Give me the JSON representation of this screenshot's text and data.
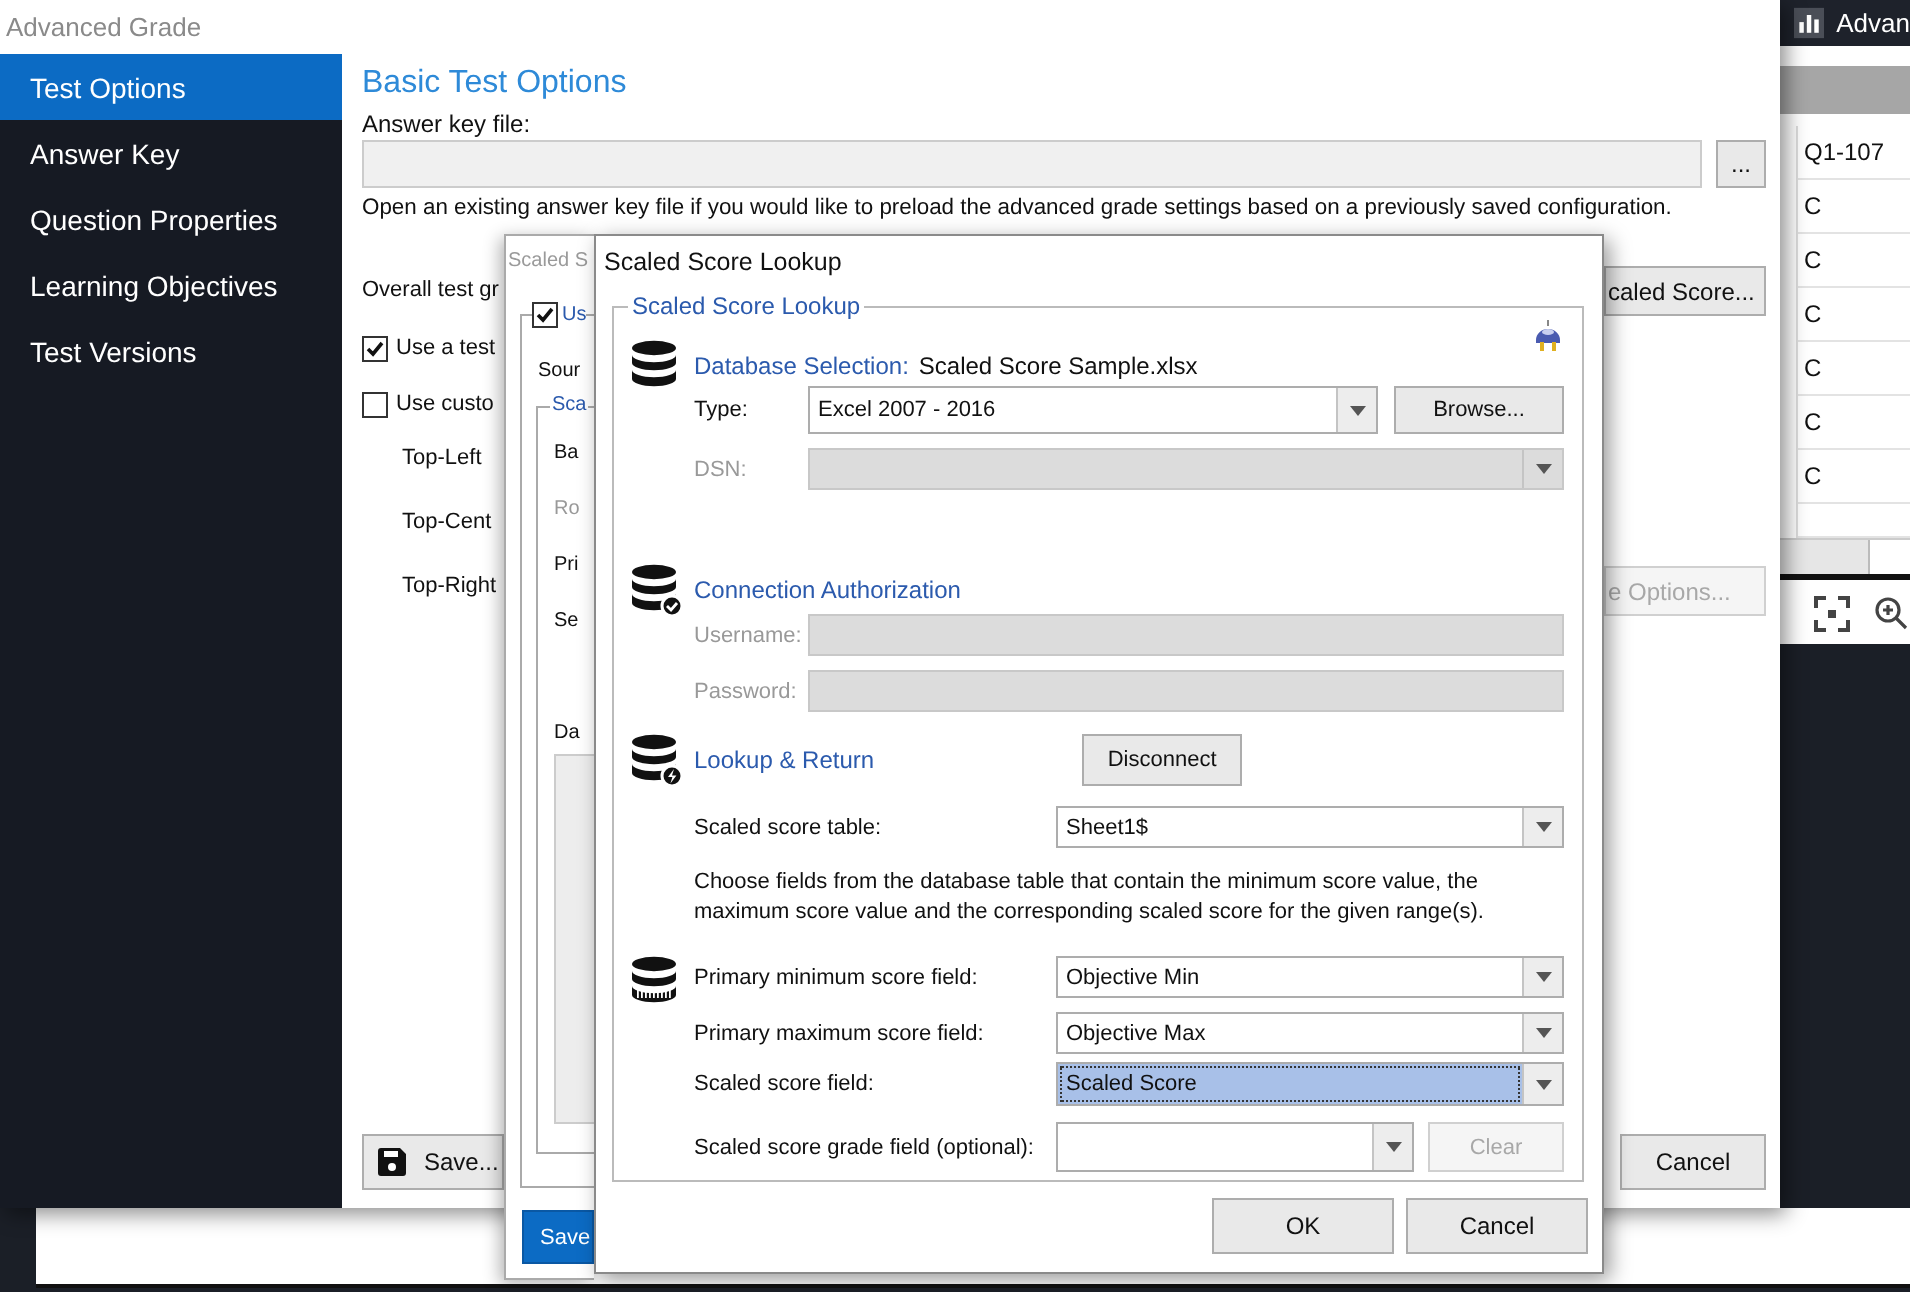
{
  "background_app": {
    "title": "Advan",
    "column_header": "Q1-107",
    "cells": [
      "C",
      "C",
      "C",
      "C",
      "C",
      "C"
    ]
  },
  "main_window": {
    "title": "Advanced Grade",
    "sidebar": [
      {
        "label": "Test Options",
        "selected": true
      },
      {
        "label": "Answer Key",
        "selected": false
      },
      {
        "label": "Question Properties",
        "selected": false
      },
      {
        "label": "Learning Objectives",
        "selected": false
      },
      {
        "label": "Test Versions",
        "selected": false
      }
    ],
    "heading": "Basic Test Options",
    "answer_key_label": "Answer key file:",
    "browse_button": "...",
    "help_text": "Open an existing answer key file if you would like to preload the advanced grade settings based on a previously saved configuration.",
    "overall_label": "Overall test gr",
    "checkboxes": [
      {
        "label": "Use a test",
        "checked": true
      },
      {
        "label": "Use custo",
        "checked": false
      }
    ],
    "position_labels": [
      "Top-Left",
      "Top-Cent",
      "Top-Right"
    ],
    "side_buttons": [
      {
        "label": "caled Score...",
        "disabled": false
      },
      {
        "label": "e Options...",
        "disabled": true
      }
    ],
    "save_button": "Save...",
    "cancel_button": "Cancel"
  },
  "scaled_window": {
    "title": "Scaled S",
    "checkbox": {
      "label": "Us",
      "checked": true
    },
    "source_label": "Sour",
    "group_title": "Sca",
    "labels": [
      {
        "text": "Ba",
        "disabled": false
      },
      {
        "text": "Ro",
        "disabled": true
      },
      {
        "text": "Pri",
        "disabled": false
      },
      {
        "text": "Se",
        "disabled": false
      }
    ],
    "list_label": "Da",
    "save_button": "Save"
  },
  "lookup_dialog": {
    "title": "Scaled Score Lookup",
    "group_title": "Scaled Score Lookup",
    "database_heading": "Database Selection:",
    "database_file": "Scaled Score Sample.xlsx",
    "type": {
      "label": "Type:",
      "value": "Excel 2007 - 2016",
      "disabled": false
    },
    "browse_button": "Browse...",
    "dsn": {
      "label": "DSN:",
      "disabled": true
    },
    "connection_heading": "Connection Authorization",
    "credentials": [
      {
        "label": "Username:",
        "disabled": true
      },
      {
        "label": "Password:",
        "disabled": true
      }
    ],
    "lookup_heading": "Lookup & Return",
    "disconnect_button": "Disconnect",
    "table": {
      "label": "Scaled score table:",
      "value": "Sheet1$"
    },
    "instructions": "Choose fields from the database table that contain the minimum score value, the maximum score value and the corresponding scaled score for the given range(s).",
    "fields": [
      {
        "label": "Primary minimum score field:",
        "value": "Objective Min",
        "selected": false
      },
      {
        "label": "Primary maximum score field:",
        "value": "Objective Max",
        "selected": false
      },
      {
        "label": "Scaled score field:",
        "value": "Scaled Score",
        "selected": true
      },
      {
        "label": "Scaled score grade field (optional):",
        "selected": false
      }
    ],
    "clear_button": {
      "label": "Clear",
      "disabled": true
    },
    "buttons": [
      "OK",
      "Cancel"
    ]
  }
}
